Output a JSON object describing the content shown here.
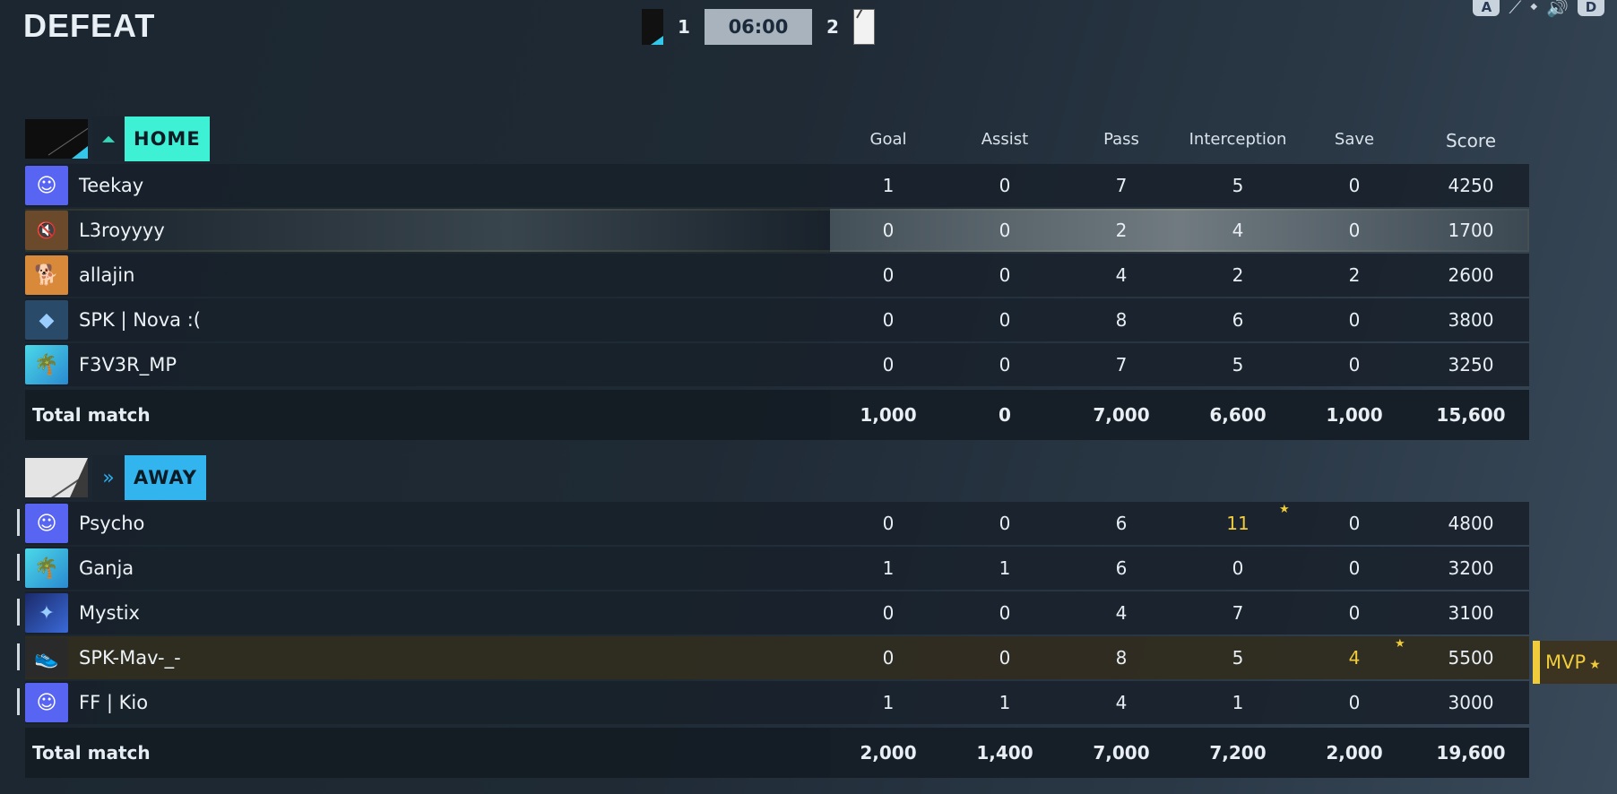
{
  "result": "DEFEAT",
  "scoreboard": {
    "home_score": "1",
    "timer": "06:00",
    "away_score": "2"
  },
  "top_icons": {
    "key_left": "A",
    "key_right": "D"
  },
  "columns": [
    "Goal",
    "Assist",
    "Pass",
    "Interception",
    "Save",
    "Score"
  ],
  "home": {
    "name": "HOME",
    "players": [
      {
        "name": "Teekay",
        "stats": [
          "1",
          "0",
          "7",
          "5",
          "0",
          "4250"
        ]
      },
      {
        "name": "L3royyyy",
        "stats": [
          "0",
          "0",
          "2",
          "4",
          "0",
          "1700"
        ]
      },
      {
        "name": "allajin",
        "stats": [
          "0",
          "0",
          "4",
          "2",
          "2",
          "2600"
        ]
      },
      {
        "name": "SPK | Nova :(",
        "stats": [
          "0",
          "0",
          "8",
          "6",
          "0",
          "3800"
        ]
      },
      {
        "name": "F3V3R_MP",
        "stats": [
          "0",
          "0",
          "7",
          "5",
          "0",
          "3250"
        ]
      }
    ],
    "total_label": "Total match",
    "totals": [
      "1,000",
      "0",
      "7,000",
      "6,600",
      "1,000",
      "15,600"
    ]
  },
  "away": {
    "name": "AWAY",
    "players": [
      {
        "name": "Psycho",
        "stats": [
          "0",
          "0",
          "6",
          "11",
          "0",
          "4800"
        ]
      },
      {
        "name": "Ganja",
        "stats": [
          "1",
          "1",
          "6",
          "0",
          "0",
          "3200"
        ]
      },
      {
        "name": "Mystix",
        "stats": [
          "0",
          "0",
          "4",
          "7",
          "0",
          "3100"
        ]
      },
      {
        "name": "SPK-Mav-_-",
        "stats": [
          "0",
          "0",
          "8",
          "5",
          "4",
          "5500"
        ]
      },
      {
        "name": "FF | Kio",
        "stats": [
          "1",
          "1",
          "4",
          "1",
          "0",
          "3000"
        ]
      }
    ],
    "total_label": "Total match",
    "totals": [
      "2,000",
      "1,400",
      "7,000",
      "7,200",
      "2,000",
      "19,600"
    ]
  },
  "mvp_label": "MVP",
  "colors": {
    "home": "#3ef0d4",
    "away": "#32b4ee",
    "highlight": "#e8c83a",
    "gold": "#f0cc3c"
  }
}
